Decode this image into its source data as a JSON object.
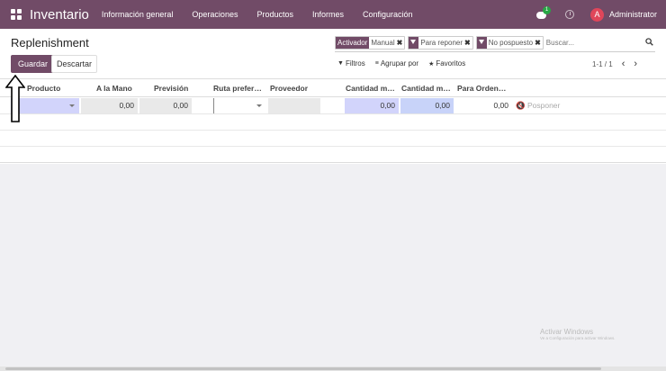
{
  "navbar": {
    "brand": "Inventario",
    "menu": [
      "Información general",
      "Operaciones",
      "Productos",
      "Informes",
      "Configuración"
    ],
    "notification_count": "1",
    "user_initial": "A",
    "user_name": "Administrator"
  },
  "control_panel": {
    "title": "Replenishment",
    "save_label": "Guardar",
    "discard_label": "Descartar"
  },
  "search": {
    "facets": [
      {
        "head": "Activador",
        "value": "Manual"
      },
      {
        "value": "Para reponer"
      },
      {
        "value": "No pospuesto"
      }
    ],
    "placeholder": "Buscar..."
  },
  "filters": {
    "filters_label": "Filtros",
    "groupby_label": "Agrupar por",
    "favorites_label": "Favoritos"
  },
  "pager": {
    "value": "1-1 / 1"
  },
  "table": {
    "columns": [
      "Producto",
      "A la Mano",
      "Previsión",
      "Ruta prefer…",
      "Proveedor",
      "Cantidad m…",
      "Cantidad m…",
      "Para Orden…"
    ],
    "row": {
      "on_hand": "0,00",
      "forecast": "0,00",
      "qty_min": "0,00",
      "qty_max": "0,00",
      "to_order": "0,00",
      "postpone_label": "Posponer"
    }
  },
  "watermark": {
    "title": "Activar Windows",
    "subtitle": "Ve a Configuración para activar Windows."
  },
  "colors": {
    "brand": "#714b67",
    "required_field": "#d2d4fb",
    "avatar": "#e0465a",
    "badge": "#28a745"
  }
}
